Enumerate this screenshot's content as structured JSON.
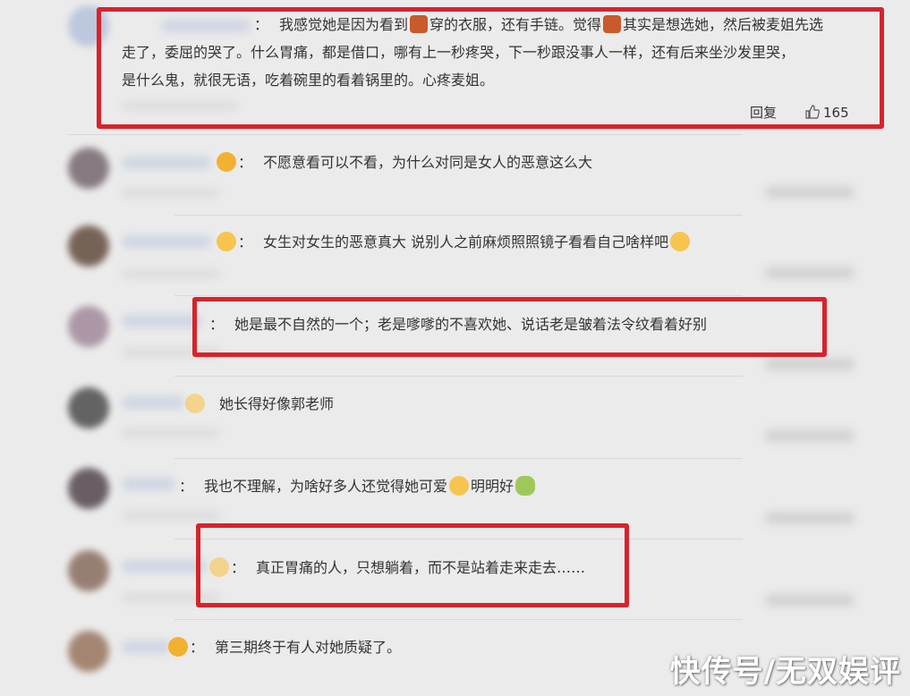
{
  "comments": [
    {
      "lines": [
        "我感觉她是因为看到",
        "穿的衣服，还有手链。觉得",
        "其实是想选她，然后被麦姐先选",
        "走了，委屈的哭了。什么胃痛，都是借口，哪有上一秒疼哭，下一秒跟没事人一样，还有后来坐沙发里哭，",
        "是什么鬼，就很无语，吃着碗里的看着锅里的。心疼麦姐。"
      ],
      "reply_label": "回复",
      "like_count": "165"
    },
    {
      "text": "不愿意看可以不看，为什么对同是女人的恶意这么大"
    },
    {
      "text": "女生对女生的恶意真大 说别人之前麻烦照照镜子看看自己啥样吧"
    },
    {
      "text": "她是最不自然的一个；老是嗲嗲的不喜欢她、说话老是皱着法令纹看着好别"
    },
    {
      "text": "她长得好像郭老师"
    },
    {
      "text_a": "我也不理解，为啥好多人还觉得她可爱",
      "text_b": "明明好"
    },
    {
      "text": "真正胃痛的人，只想躺着，而不是站着走来走去……"
    },
    {
      "text": "第三期终于有人对她质疑了。"
    }
  ],
  "colon": "：",
  "icons": {
    "horse": "horse-emoji-icon",
    "crown": "crown-emoji-icon",
    "shy": "shy-emoji-icon",
    "cry": "laugh-cry-emoji-icon",
    "bowl": "tea-bowl-emoji-icon",
    "like": "thumbs-up-icon"
  },
  "watermark": "快传号/无双娱评",
  "colors": {
    "highlight": "#d7232d"
  }
}
